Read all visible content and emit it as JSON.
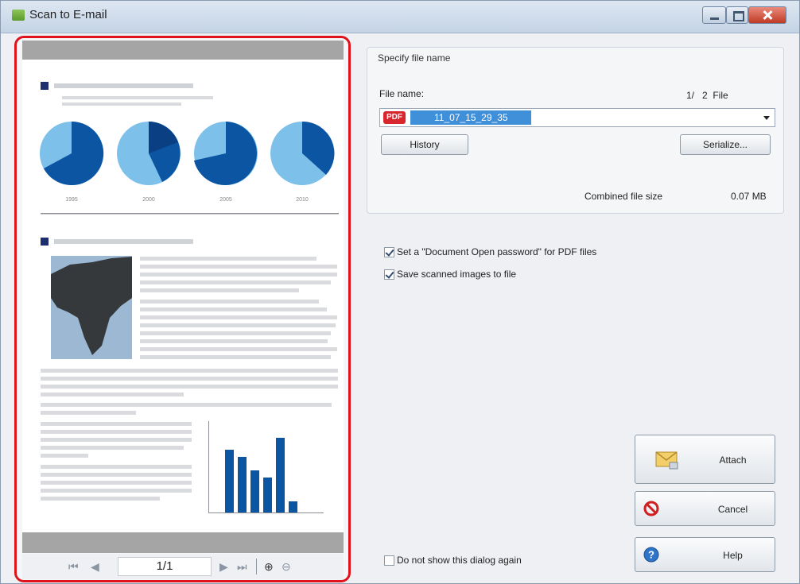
{
  "window": {
    "title": "Scan to E-mail"
  },
  "preview": {
    "page_counter": "1/1",
    "chart_years": [
      "1995",
      "2000",
      "2005",
      "2010"
    ]
  },
  "file_group": {
    "legend": "Specify file name",
    "file_name_label": "File name:",
    "file_counter": "1/   2  File",
    "file_name_value": "11_07_15_29_35",
    "pdf_badge": "PDF",
    "history_button": "History",
    "serialize_button": "Serialize...",
    "combined_size_label": "Combined file size",
    "combined_size_value": "0.07 MB"
  },
  "options": {
    "doc_open_password": "Set a \"Document Open password\" for PDF files",
    "save_scanned": "Save scanned images to file",
    "do_not_show": "Do not show this dialog again"
  },
  "actions": {
    "attach": "Attach",
    "cancel": "Cancel",
    "help": "Help"
  },
  "colors": {
    "highlight_border": "#e0121b",
    "pie_dark": "#0b55a3",
    "pie_light": "#7dc0ea"
  }
}
